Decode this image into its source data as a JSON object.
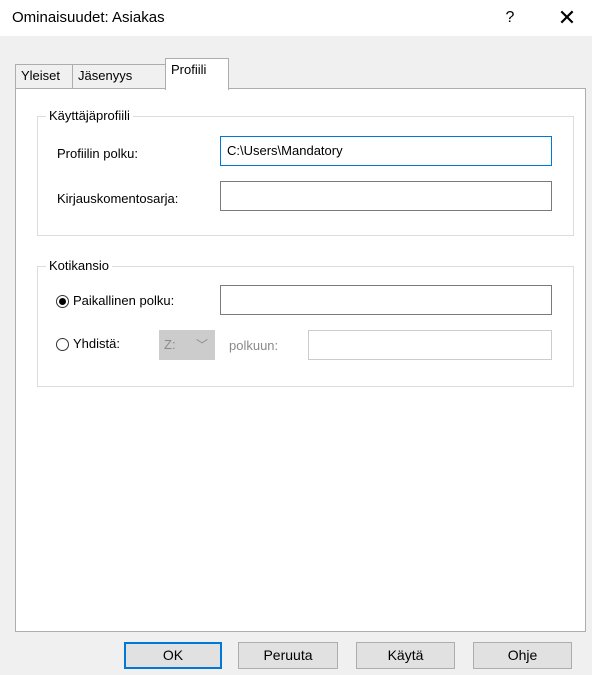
{
  "window": {
    "title": "Ominaisuudet: Asiakas",
    "help_label": "?",
    "close_label": "✕"
  },
  "tabs": [
    {
      "label": "Yleiset",
      "active": false
    },
    {
      "label": "Jäsenyys",
      "active": false
    },
    {
      "label": "Profiili",
      "active": true
    }
  ],
  "user_profile": {
    "group_title": "Käyttäjäprofiili",
    "profile_path_label": "Profiilin polku:",
    "profile_path_value": "C:\\Users\\Mandatory",
    "logon_script_label": "Kirjauskomentosarja:",
    "logon_script_value": ""
  },
  "home_folder": {
    "group_title": "Kotikansio",
    "local_path_label": "Paikallinen polku:",
    "local_path_value": "",
    "local_path_selected": true,
    "connect_label": "Yhdistä:",
    "drive_value": "Z:",
    "to_label": "polkuun:",
    "to_value": ""
  },
  "buttons": {
    "ok": "OK",
    "cancel": "Peruuta",
    "apply": "Käytä",
    "help": "Ohje"
  }
}
